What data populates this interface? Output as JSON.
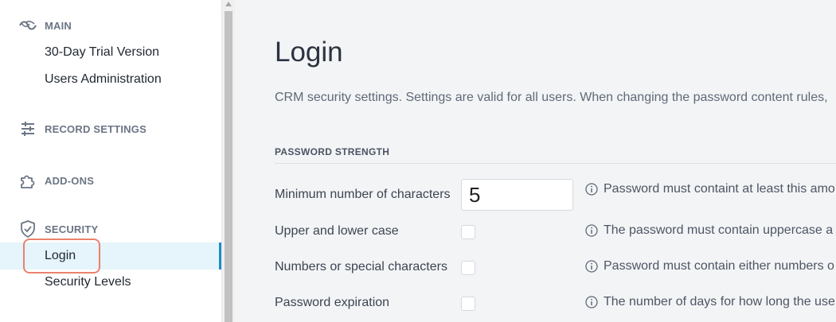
{
  "sidebar": {
    "main_header": "MAIN",
    "items_main": [
      {
        "label": "30-Day Trial Version"
      },
      {
        "label": "Users Administration"
      }
    ],
    "record_settings_header": "RECORD SETTINGS",
    "addons_header": "ADD-ONS",
    "security_header": "SECURITY",
    "items_security": [
      {
        "label": "Login",
        "active": true
      },
      {
        "label": "Security Levels"
      }
    ]
  },
  "main": {
    "title": "Login",
    "description": "CRM security settings. Settings are valid for all users. When changing the password content rules,",
    "password_strength": {
      "heading": "PASSWORD STRENGTH",
      "rows": [
        {
          "label": "Minimum number of characters",
          "value": "5",
          "hint": "Password must containt at least this amo"
        },
        {
          "label": "Upper and lower case",
          "checked": false,
          "hint": "The password must contain uppercase a"
        },
        {
          "label": "Numbers or special characters",
          "checked": false,
          "hint": "Password must contain either numbers o"
        },
        {
          "label": "Password expiration",
          "checked": false,
          "hint": "The number of days for how long the use"
        }
      ]
    }
  },
  "colors": {
    "accent": "#1e8cc8",
    "active_bg": "#e6f4fb",
    "highlight": "#e8826c"
  },
  "icons": [
    "logo-icon",
    "sliders-icon",
    "puzzle-icon",
    "shield-check-icon",
    "info-icon"
  ]
}
